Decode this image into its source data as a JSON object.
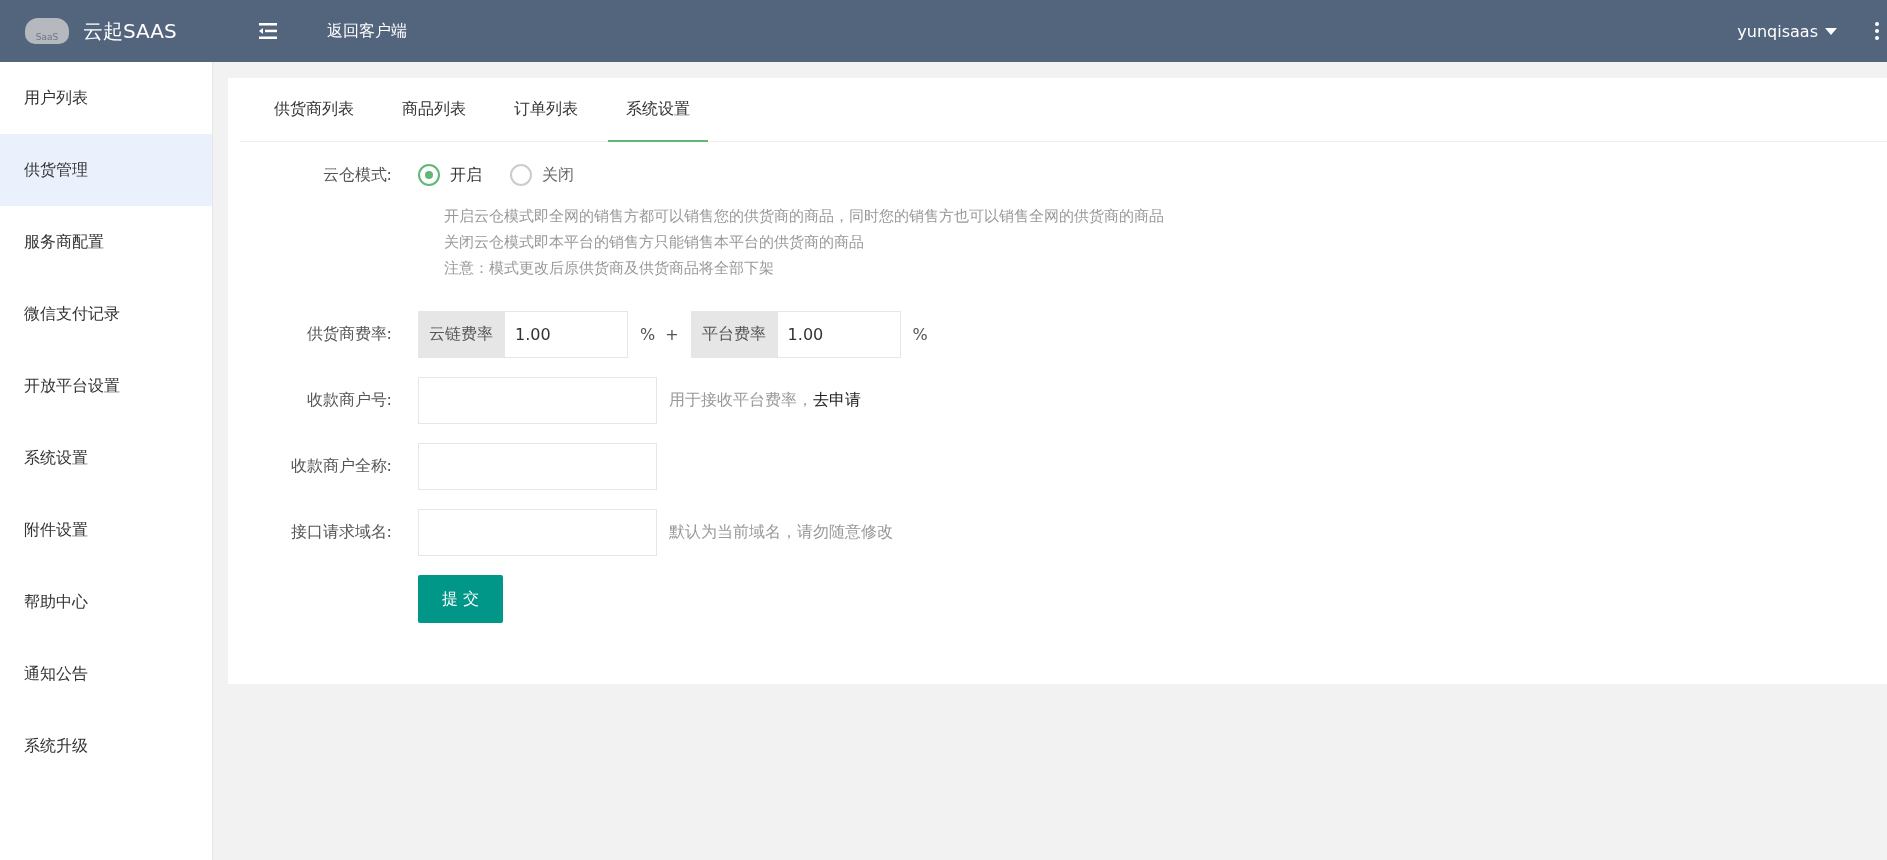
{
  "header": {
    "logo_badge": "SaaS",
    "brand": "云起SAAS",
    "back_link": "返回客户端",
    "user": "yunqisaas"
  },
  "sidebar": {
    "items": [
      {
        "label": "用户列表",
        "selected": false
      },
      {
        "label": "供货管理",
        "selected": true
      },
      {
        "label": "服务商配置",
        "selected": false
      },
      {
        "label": "微信支付记录",
        "selected": false
      },
      {
        "label": "开放平台设置",
        "selected": false
      },
      {
        "label": "系统设置",
        "selected": false
      },
      {
        "label": "附件设置",
        "selected": false
      },
      {
        "label": "帮助中心",
        "selected": false
      },
      {
        "label": "通知公告",
        "selected": false
      },
      {
        "label": "系统升级",
        "selected": false
      }
    ]
  },
  "tabs": [
    {
      "label": "供货商列表",
      "selected": false
    },
    {
      "label": "商品列表",
      "selected": false
    },
    {
      "label": "订单列表",
      "selected": false
    },
    {
      "label": "系统设置",
      "selected": true
    }
  ],
  "form": {
    "cloud_mode": {
      "label": "云仓模式:",
      "options": [
        {
          "label": "开启",
          "selected": true
        },
        {
          "label": "关闭",
          "selected": false
        }
      ],
      "notes": [
        "开启云仓模式即全网的销售方都可以销售您的供货商的商品，同时您的销售方也可以销售全网的供货商的商品",
        "关闭云仓模式即本平台的销售方只能销售本平台的供货商的商品",
        "注意：模式更改后原供货商及供货商品将全部下架"
      ]
    },
    "fee": {
      "label": "供货商费率:",
      "cloud_prefix": "云链费率",
      "cloud_value": "1.00",
      "unit_1": "%",
      "plus": "+",
      "platform_prefix": "平台费率",
      "platform_value": "1.00",
      "unit_2": "%"
    },
    "merchant_no": {
      "label": "收款商户号:",
      "hint": "用于接收平台费率，",
      "link": "去申请"
    },
    "merchant_name": {
      "label": "收款商户全称:"
    },
    "domain": {
      "label": "接口请求域名:",
      "hint": "默认为当前域名，请勿随意修改"
    },
    "submit": "提 交"
  }
}
